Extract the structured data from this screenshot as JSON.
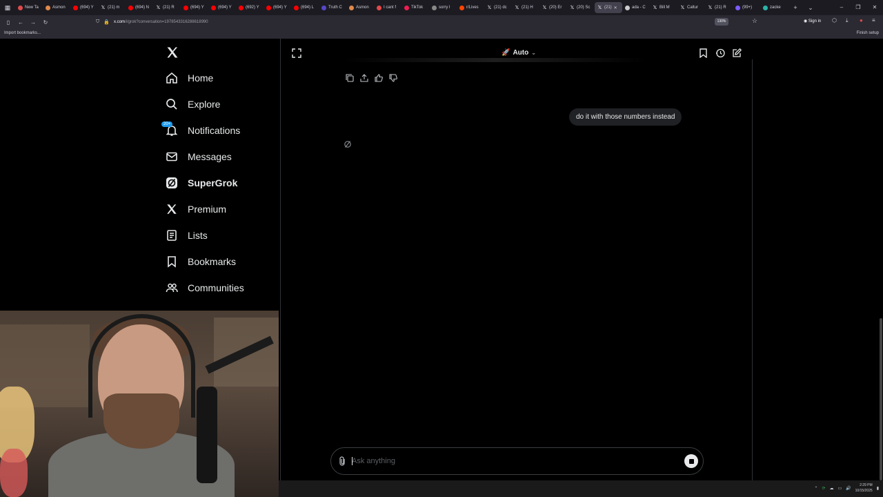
{
  "browser": {
    "tabs": [
      {
        "label": "New Ta",
        "color": "#e24a4a"
      },
      {
        "label": "Asmon",
        "color": "#e2894a"
      },
      {
        "label": "(694) Y",
        "color": "#ff0000"
      },
      {
        "label": "(21) m",
        "icon": "x"
      },
      {
        "label": "(694) N",
        "color": "#ff0000"
      },
      {
        "label": "(21) R",
        "icon": "x"
      },
      {
        "label": "(694) Y",
        "color": "#ff0000"
      },
      {
        "label": "(694) Y",
        "color": "#ff0000"
      },
      {
        "label": "(692) Y",
        "color": "#ff0000"
      },
      {
        "label": "(694) Y",
        "color": "#ff0000"
      },
      {
        "label": "(694) L",
        "color": "#ff0000"
      },
      {
        "label": "Truth C",
        "color": "#5448c8"
      },
      {
        "label": "Asmon",
        "color": "#e2894a"
      },
      {
        "label": "I cant f",
        "color": "#e24a4a"
      },
      {
        "label": "TikTok",
        "color": "#ee1d52"
      },
      {
        "label": "sorry l",
        "color": "#888888"
      },
      {
        "label": "r/Lives",
        "color": "#ff4500"
      },
      {
        "label": "(21) dc",
        "icon": "x"
      },
      {
        "label": "(21) H",
        "icon": "x"
      },
      {
        "label": "(20) Er",
        "icon": "x"
      },
      {
        "label": "(20) Sc",
        "icon": "x"
      },
      {
        "label": "(21)",
        "icon": "x",
        "active": true
      },
      {
        "label": "ada - C",
        "color": "#cccccc"
      },
      {
        "label": "Bill M",
        "icon": "x"
      },
      {
        "label": "Caltur",
        "icon": "x"
      },
      {
        "label": "(21) R",
        "icon": "x"
      },
      {
        "label": "(99+)",
        "color": "#7b5cff"
      },
      {
        "label": "zacke",
        "color": "#2bb3a8"
      }
    ],
    "url_main": "x.com",
    "url_rest": "/i/grok?conversation=1978543316288618990",
    "zoom": "130%",
    "sign_in": "Sign in",
    "bookmarks_import": "Import bookmarks...",
    "finish_setup": "Finish setup"
  },
  "sidebar": {
    "items": [
      {
        "label": "Home",
        "icon": "home-icon"
      },
      {
        "label": "Explore",
        "icon": "search-icon"
      },
      {
        "label": "Notifications",
        "icon": "bell-icon",
        "badge": "20+"
      },
      {
        "label": "Messages",
        "icon": "mail-icon"
      },
      {
        "label": "SuperGrok",
        "icon": "grok-icon",
        "bold": true
      },
      {
        "label": "Premium",
        "icon": "x-logo-icon"
      },
      {
        "label": "Lists",
        "icon": "list-icon"
      },
      {
        "label": "Bookmarks",
        "icon": "bookmark-icon"
      },
      {
        "label": "Communities",
        "icon": "people-icon"
      }
    ]
  },
  "grok": {
    "mode_label": "Auto",
    "user_message": "do it with those numbers instead",
    "composer_placeholder": "Ask anything"
  },
  "taskbar": {
    "time": "2:29 PM",
    "date": "10/15/2025"
  }
}
